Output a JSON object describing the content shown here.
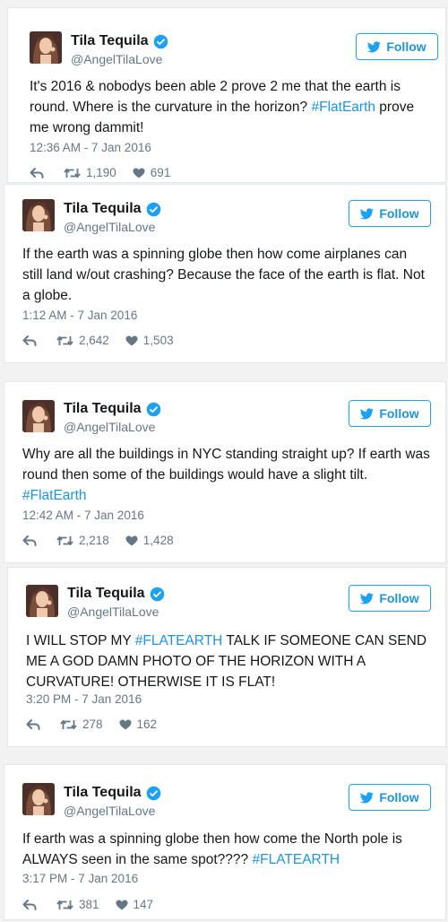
{
  "button": {
    "follow_label": "Follow"
  },
  "tweets": [
    {
      "name": "Tila Tequila",
      "handle": "@AngelTilaLove",
      "text": [
        {
          "t": "It's 2016 & nobodys been able 2 prove 2 me that the earth is round. Where is the curvature in the horizon? "
        },
        {
          "t": "#FlatEarth",
          "tag": true
        },
        {
          "t": " prove me wrong dammit!"
        }
      ],
      "timestamp": "12:36 AM - 7 Jan 2016",
      "retweets": "1,190",
      "likes": "691"
    },
    {
      "name": "Tila Tequila",
      "handle": "@AngelTilaLove",
      "text": [
        {
          "t": "If the earth was a spinning globe then how come airplanes can still land w/out crashing? Because the face of the earth is flat. Not a globe."
        }
      ],
      "timestamp": "1:12 AM - 7 Jan 2016",
      "retweets": "2,642",
      "likes": "1,503"
    },
    {
      "name": "Tila Tequila",
      "handle": "@AngelTilaLove",
      "text": [
        {
          "t": "Why are all the buildings in NYC standing straight up? If earth was round then some of the buildings would have a slight tilt. "
        },
        {
          "t": "#FlatEarth",
          "tag": true
        }
      ],
      "timestamp": "12:42 AM - 7 Jan 2016",
      "retweets": "2,218",
      "likes": "1,428"
    },
    {
      "name": "Tila Tequila",
      "handle": "@AngelTilaLove",
      "text": [
        {
          "t": "I WILL STOP MY "
        },
        {
          "t": "#FLATEARTH",
          "tag": true
        },
        {
          "t": " TALK IF SOMEONE CAN SEND ME A GOD DAMN PHOTO OF THE HORIZON WITH A CURVATURE! OTHERWISE IT IS FLAT!"
        }
      ],
      "timestamp": "3:20 PM - 7 Jan 2016",
      "retweets": "278",
      "likes": "162"
    },
    {
      "name": "Tila Tequila",
      "handle": "@AngelTilaLove",
      "text": [
        {
          "t": "If earth was a spinning globe then how come the North pole is ALWAYS seen in the same spot???? "
        },
        {
          "t": "#FLATEARTH",
          "tag": true
        }
      ],
      "timestamp": "3:17 PM - 7 Jan 2016",
      "retweets": "381",
      "likes": "147"
    }
  ],
  "colors": {
    "accent": "#1da1f2",
    "link": "#1b95e0",
    "muted": "#657786",
    "text": "#14171a"
  },
  "icons": [
    "verified-badge-icon",
    "twitter-bird-icon",
    "reply-icon",
    "retweet-icon",
    "heart-icon"
  ]
}
